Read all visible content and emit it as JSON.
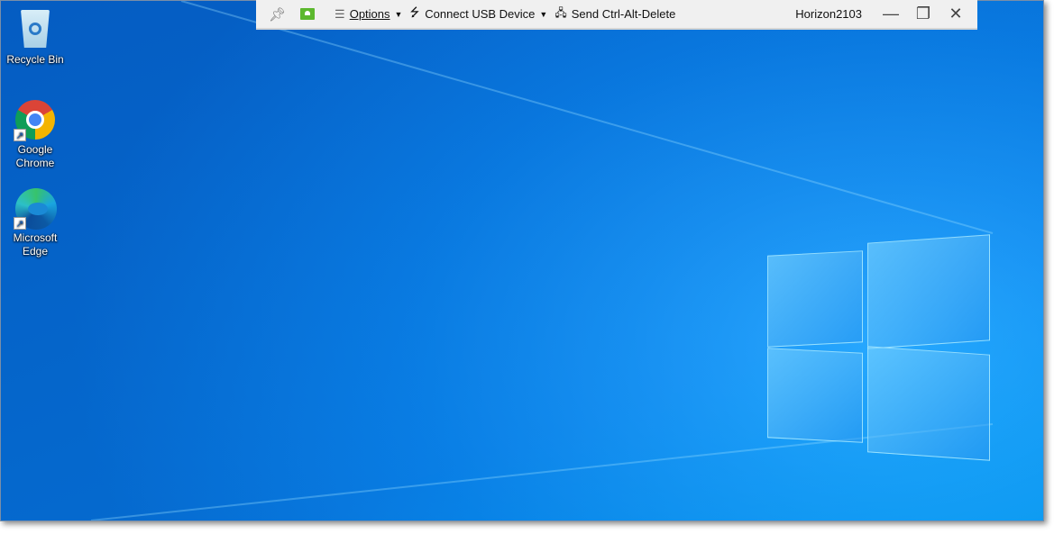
{
  "desktop": {
    "icons": [
      {
        "label_lines": [
          "Recycle Bin"
        ],
        "icon": "recycle-bin-icon"
      },
      {
        "label_lines": [
          "Google",
          "Chrome"
        ],
        "icon": "chrome-icon",
        "shortcut": true
      },
      {
        "label_lines": [
          "Microsoft",
          "Edge"
        ],
        "icon": "edge-icon",
        "shortcut": true
      }
    ]
  },
  "toolbar": {
    "pin_icon": "pin-icon",
    "display_icon": "monitor-icon",
    "options_label": "Options",
    "usb_label": "Connect USB Device",
    "cad_label": "Send Ctrl-Alt-Delete",
    "host": "Horizon2103"
  },
  "colors": {
    "toolbar_bg": "#f0f0f0",
    "desktop_blue": "#0a78e0",
    "display_icon": "#5cb82e"
  }
}
